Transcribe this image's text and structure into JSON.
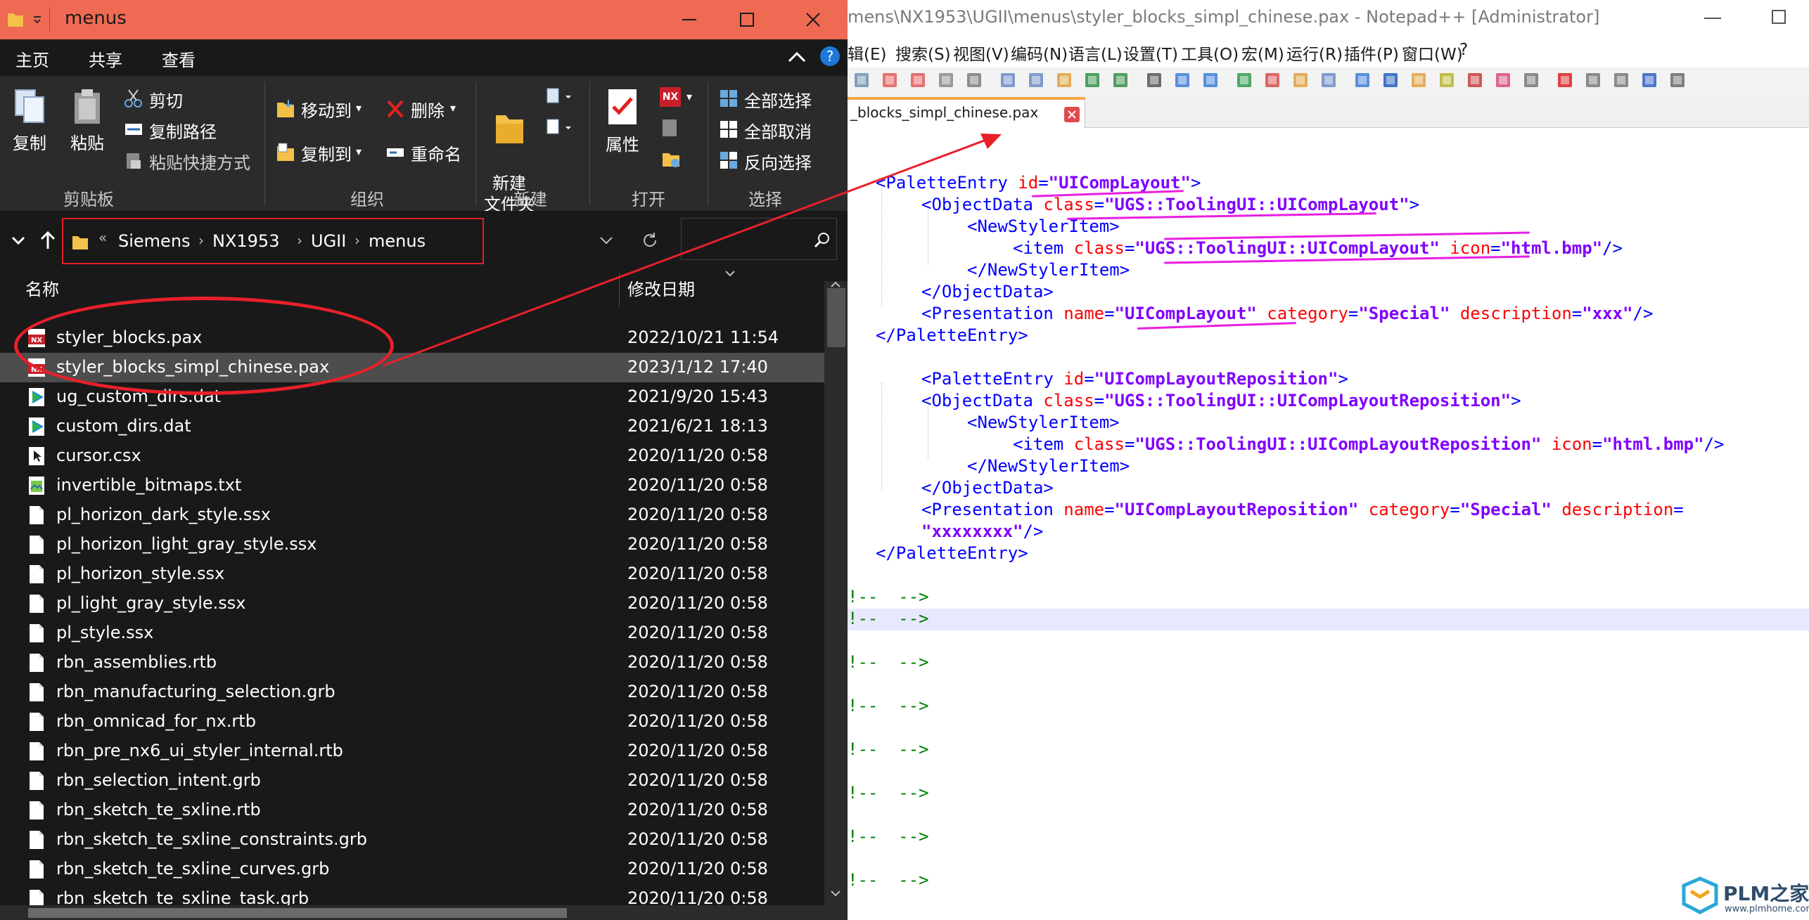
{
  "explorer": {
    "title": "menus",
    "tabs": [
      "主页",
      "共享",
      "查看"
    ],
    "ribbon": {
      "copy": "复制",
      "paste": "粘贴",
      "cut": "剪切",
      "copy_path": "复制路径",
      "paste_shortcut": "粘贴快捷方式",
      "move_to": "移动到",
      "copy_to": "复制到",
      "delete": "删除",
      "rename": "重命名",
      "new_folder": "新建\n文件夹",
      "properties": "属性",
      "select_all": "全部选择",
      "select_none": "全部取消",
      "invert_selection": "反向选择",
      "groups": [
        "剪贴板",
        "组织",
        "新建",
        "打开",
        "选择"
      ]
    },
    "breadcrumb": [
      "Siemens",
      "NX1953",
      "UGII",
      "menus"
    ],
    "columns": {
      "name": "名称",
      "modified": "修改日期"
    },
    "files": [
      {
        "name": "styler_blocks.pax",
        "date": "2022/10/21 11:54",
        "icon": "nx",
        "selected": false
      },
      {
        "name": "styler_blocks_simpl_chinese.pax",
        "date": "2023/1/12 17:40",
        "icon": "nx",
        "selected": true
      },
      {
        "name": "ug_custom_dirs.dat",
        "date": "2021/9/20 15:43",
        "icon": "play",
        "selected": false
      },
      {
        "name": "custom_dirs.dat",
        "date": "2021/6/21 18:13",
        "icon": "play",
        "selected": false
      },
      {
        "name": "cursor.csx",
        "date": "2020/11/20 0:58",
        "icon": "cursor",
        "selected": false
      },
      {
        "name": "invertible_bitmaps.txt",
        "date": "2020/11/20 0:58",
        "icon": "txt",
        "selected": false
      },
      {
        "name": "pl_horizon_dark_style.ssx",
        "date": "2020/11/20 0:58",
        "icon": "doc",
        "selected": false
      },
      {
        "name": "pl_horizon_light_gray_style.ssx",
        "date": "2020/11/20 0:58",
        "icon": "doc",
        "selected": false
      },
      {
        "name": "pl_horizon_style.ssx",
        "date": "2020/11/20 0:58",
        "icon": "doc",
        "selected": false
      },
      {
        "name": "pl_light_gray_style.ssx",
        "date": "2020/11/20 0:58",
        "icon": "doc",
        "selected": false
      },
      {
        "name": "pl_style.ssx",
        "date": "2020/11/20 0:58",
        "icon": "doc",
        "selected": false
      },
      {
        "name": "rbn_assemblies.rtb",
        "date": "2020/11/20 0:58",
        "icon": "doc",
        "selected": false
      },
      {
        "name": "rbn_manufacturing_selection.grb",
        "date": "2020/11/20 0:58",
        "icon": "doc",
        "selected": false
      },
      {
        "name": "rbn_omnicad_for_nx.rtb",
        "date": "2020/11/20 0:58",
        "icon": "doc",
        "selected": false
      },
      {
        "name": "rbn_pre_nx6_ui_styler_internal.rtb",
        "date": "2020/11/20 0:58",
        "icon": "doc",
        "selected": false
      },
      {
        "name": "rbn_selection_intent.grb",
        "date": "2020/11/20 0:58",
        "icon": "doc",
        "selected": false
      },
      {
        "name": "rbn_sketch_te_sxline.rtb",
        "date": "2020/11/20 0:58",
        "icon": "doc",
        "selected": false
      },
      {
        "name": "rbn_sketch_te_sxline_constraints.grb",
        "date": "2020/11/20 0:58",
        "icon": "doc",
        "selected": false
      },
      {
        "name": "rbn_sketch_te_sxline_curves.grb",
        "date": "2020/11/20 0:58",
        "icon": "doc",
        "selected": false
      },
      {
        "name": "rbn_sketch_te_sxline_task.grb",
        "date": "2020/11/20 0:58",
        "icon": "doc",
        "selected": false
      }
    ]
  },
  "notepad": {
    "title": "mens\\NX1953\\UGII\\menus\\styler_blocks_simpl_chinese.pax - Notepad++ [Administrator]",
    "menu": [
      "辑(E)",
      "搜索(S)",
      "视图(V)",
      "编码(N)",
      "语言(L)",
      "设置(T)",
      "工具(O)",
      "宏(M)",
      "运行(R)",
      "插件(P)",
      "窗口(W)",
      "?"
    ],
    "tab_label": "_blocks_simpl_chinese.pax",
    "code": {
      "l1_tag": "<PaletteEntry",
      "l1_attr": "id",
      "l1_eq": "=",
      "l1_val": "\"UICompLayout\"",
      "l1_end": ">",
      "l2_tag": "<ObjectData",
      "l2_attr": "class",
      "l2_eq": "=",
      "l2_val": "\"UGS::ToolingUI::UICompLayout\"",
      "l2_end": ">",
      "l3_tag": "<NewStylerItem>",
      "l4_tag": "<item",
      "l4_attr1": "class",
      "l4_eq1": "=",
      "l4_val1": "\"UGS::ToolingUI::UICompLayout\"",
      "l4_attr2": "icon",
      "l4_eq2": "=",
      "l4_val2": "\"html.bmp\"",
      "l4_end": "/>",
      "l5_tag": "</NewStylerItem>",
      "l6_tag": "</ObjectData>",
      "l7_tag": "<Presentation",
      "l7_attr1": "name",
      "l7_eq1": "=",
      "l7_val1": "\"UICompLayout\"",
      "l7_attr2": "category",
      "l7_eq2": "=",
      "l7_val2": "\"Special\"",
      "l7_attr3": "description",
      "l7_eq3": "=",
      "l7_val3": "\"xxx\"",
      "l7_end": "/>",
      "l8_tag": "</PaletteEntry>",
      "l10_tag": "<PaletteEntry",
      "l10_attr": "id",
      "l10_eq": "=",
      "l10_val": "\"UICompLayoutReposition\"",
      "l10_end": ">",
      "l11_tag": "<ObjectData",
      "l11_attr": "class",
      "l11_eq": "=",
      "l11_val": "\"UGS::ToolingUI::UICompLayoutReposition\"",
      "l11_end": ">",
      "l12_tag": "<NewStylerItem>",
      "l13_tag": "<item",
      "l13_attr1": "class",
      "l13_eq1": "=",
      "l13_val1": "\"UGS::ToolingUI::UICompLayoutReposition\"",
      "l13_attr2": "icon",
      "l13_eq2": "=",
      "l13_val2": "\"html.bmp\"",
      "l13_end": "/>",
      "l14_tag": "</NewStylerItem>",
      "l15_tag": "</ObjectData>",
      "l16_tag": "<Presentation",
      "l16_attr1": "name",
      "l16_eq1": "=",
      "l16_val1": "\"UICompLayoutReposition\"",
      "l16_attr2": "category",
      "l16_eq2": "=",
      "l16_val2": "\"Special\"",
      "l16_attr3": "description",
      "l16_eq3": "=",
      "l17_val": "\"xxxxxxxx\"",
      "l17_end": "/>",
      "l18_tag": "</PaletteEntry>",
      "comment": "!--  -->"
    }
  },
  "watermark": {
    "brand": "PLM之家",
    "url": "www.plmhome.com"
  },
  "colors": {
    "explorer_title": "#ee6a52",
    "annotation_red": "#e8202a",
    "annotation_magenta": "#e81ee3"
  }
}
